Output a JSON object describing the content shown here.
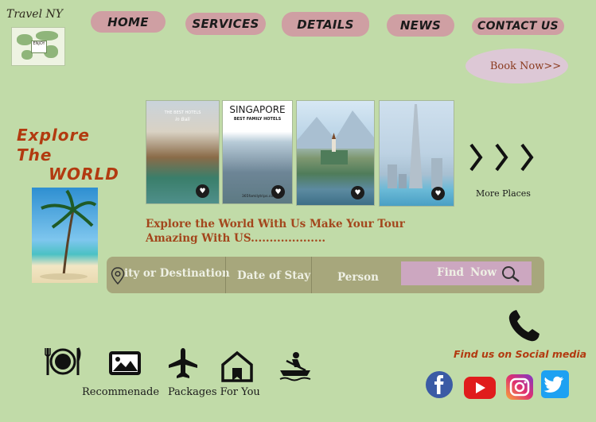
{
  "brand": {
    "name": "Travel NY",
    "logo_badge": "ENJOY"
  },
  "nav": {
    "items": [
      {
        "id": "home",
        "label": "HOME"
      },
      {
        "id": "services",
        "label": "SERVICES"
      },
      {
        "id": "details",
        "label": "DETAILS"
      },
      {
        "id": "news",
        "label": "NEWS"
      },
      {
        "id": "contact",
        "label": "CONTACT US"
      }
    ]
  },
  "book_now": {
    "label": "Book Now>>"
  },
  "hero": {
    "explore": [
      "Explore",
      "The",
      "WORLD"
    ],
    "tagline": "Explore the World With Us Make Your Tour Amazing With US...................."
  },
  "places": {
    "cards": [
      {
        "caption_top": "THE BEST HOTELS",
        "caption_sub": "in Bali"
      },
      {
        "caption_top": "SINGAPORE",
        "caption_sub": "BEST FAMILY HOTELS",
        "footer": "365familytrips.co"
      },
      {
        "caption_top": "",
        "caption_sub": ""
      },
      {
        "caption_top": "",
        "caption_sub": ""
      }
    ],
    "more_label": "More Places"
  },
  "search": {
    "destination_label": "ity or Destination",
    "date_label": "Date of Stay",
    "person_label": "Person",
    "find_label": "Find",
    "now_label": "Now"
  },
  "social": {
    "label": "Find us on Social media"
  },
  "bottom": {
    "recommend_label": "Recommenade",
    "packages_label": "Packages For You"
  },
  "colors": {
    "background": "#c1dba8",
    "nav_button": "#cf9fa3",
    "accent": "#b23a10",
    "search_bar": "#a7a77c",
    "find_button": "#cca7c0"
  },
  "icons": {
    "nav": [],
    "search": [
      "location-pin-icon",
      "search-icon"
    ],
    "contact": [
      "phone-icon"
    ],
    "social": [
      "facebook-icon",
      "youtube-icon",
      "instagram-icon",
      "twitter-icon"
    ],
    "bottom": [
      "restaurant-icon",
      "image-icon",
      "airplane-icon",
      "house-icon",
      "boat-icon"
    ]
  }
}
